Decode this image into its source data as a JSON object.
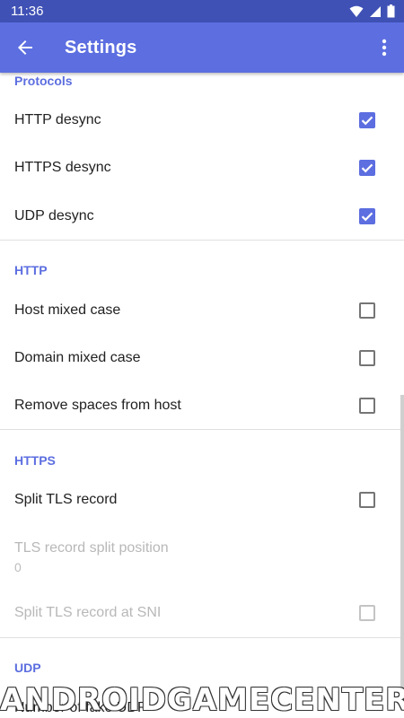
{
  "status_bar": {
    "time": "11:36"
  },
  "app_bar": {
    "title": "Settings"
  },
  "sections": {
    "protocols": {
      "header": "Protocols",
      "http_desync": {
        "label": "HTTP desync",
        "checked": true
      },
      "https_desync": {
        "label": "HTTPS desync",
        "checked": true
      },
      "udp_desync": {
        "label": "UDP desync",
        "checked": true
      }
    },
    "http": {
      "header": "HTTP",
      "host_mixed_case": {
        "label": "Host mixed case",
        "checked": false
      },
      "domain_mixed_case": {
        "label": "Domain mixed case",
        "checked": false
      },
      "remove_spaces": {
        "label": "Remove spaces from host",
        "checked": false
      }
    },
    "https": {
      "header": "HTTPS",
      "split_tls_record": {
        "label": "Split TLS record",
        "checked": false
      },
      "tls_split_position": {
        "label": "TLS record split position",
        "value": "0",
        "enabled": false
      },
      "split_tls_at_sni": {
        "label": "Split TLS record at SNI",
        "checked": false,
        "enabled": false
      }
    },
    "udp": {
      "header": "UDP",
      "fake_udp_count": {
        "label": "Number of fake UDP"
      }
    }
  },
  "watermark": "ANDROIDGAMECENTER.LA",
  "colors": {
    "accent": "#5c6ee0",
    "status_bar": "#3f51b5",
    "disabled_text": "#b8b8b8"
  },
  "icons": {
    "back": "arrow-left-icon",
    "overflow": "more-vert-icon",
    "wifi": "wifi-icon",
    "signal": "cell-signal-icon",
    "battery": "battery-icon"
  }
}
